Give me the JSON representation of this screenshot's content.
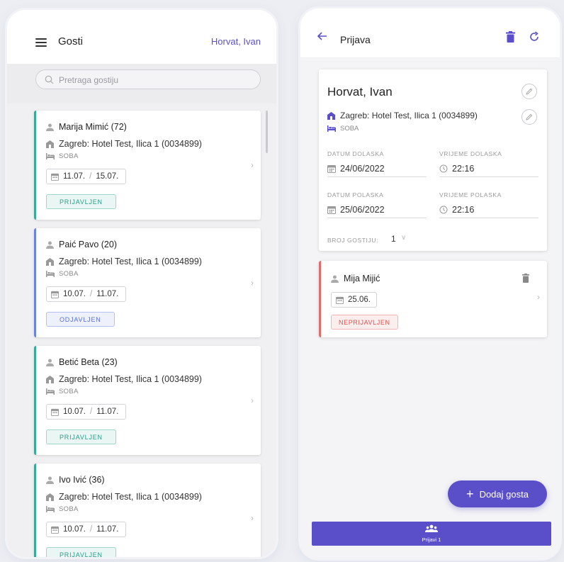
{
  "left": {
    "title": "Gosti",
    "user": "Horvat, Ivan",
    "search_placeholder": "Pretraga gostiju",
    "guests": [
      {
        "name": "Marija Mimić (72)",
        "hotel": "Zagreb: Hotel Test, Ilica 1 (0034899)",
        "room": "SOBA",
        "date_from": "11.07.",
        "date_to": "15.07.",
        "status": "PRIJAVLJEN",
        "status_color": "green"
      },
      {
        "name": "Paić Pavo (20)",
        "hotel": "Zagreb: Hotel Test, Ilica 1 (0034899)",
        "room": "SOBA",
        "date_from": "10.07.",
        "date_to": "11.07.",
        "status": "ODJAVLJEN",
        "status_color": "blue"
      },
      {
        "name": "Betić Beta (23)",
        "hotel": "Zagreb: Hotel Test, Ilica 1 (0034899)",
        "room": "SOBA",
        "date_from": "10.07.",
        "date_to": "11.07.",
        "status": "PRIJAVLJEN",
        "status_color": "green"
      },
      {
        "name": "Ivo Ivić (36)",
        "hotel": "Zagreb: Hotel Test, Ilica 1 (0034899)",
        "room": "SOBA",
        "date_from": "10.07.",
        "date_to": "11.07.",
        "status": "PRIJAVLJEN",
        "status_color": "green"
      }
    ],
    "date_separator": "/"
  },
  "right": {
    "title": "Prijava",
    "detail": {
      "name": "Horvat, Ivan",
      "hotel": "Zagreb: Hotel Test, Ilica 1 (0034899)",
      "room": "SOBA",
      "arrival_date_label": "DATUM DOLASKA",
      "arrival_date": "24/06/2022",
      "arrival_time_label": "VRIJEME DOLASKA",
      "arrival_time": "22:16",
      "departure_date_label": "DATUM POLASKA",
      "departure_date": "25/06/2022",
      "departure_time_label": "VRIJEME POLASKA",
      "departure_time": "22:16",
      "guests_label": "BROJ GOSTIJU:",
      "guests_count": "1"
    },
    "guest": {
      "name": "Mija Mijić",
      "date": "25.06.",
      "status": "NEPRIJAVLJEN"
    },
    "fab_label": "Dodaj gosta",
    "bottom_label": "Prijavi 1"
  },
  "colors": {
    "accent": "#5a4fc9",
    "green": "#3aa899",
    "blue": "#6a82e0",
    "red": "#e06b6b"
  }
}
